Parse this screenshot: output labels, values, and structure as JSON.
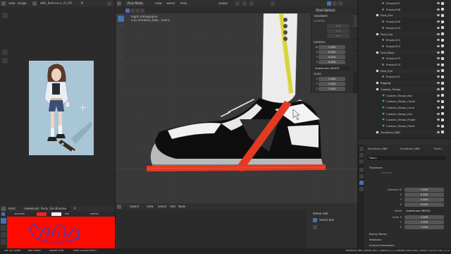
{
  "left_editor": {
    "menu": [
      "View",
      "Image"
    ],
    "image_name": "HBG_Reference_01.JPG"
  },
  "paint_editor": {
    "mode": "Paint",
    "menu": [
      "View",
      "Brush"
    ],
    "brush_name": "Body_SkinShadow",
    "tool_row": {
      "tex_label": "TexDraw",
      "blend": "Mix",
      "radius_label": "Radius"
    }
  },
  "viewport": {
    "mode": "Pose Mode",
    "menu": [
      "View",
      "Select",
      "Pose"
    ],
    "transform_orientation": "Global",
    "view_name": "Right Orthographic",
    "object_info": "(14) Armature_HBG : Foot.L",
    "pose_options": "Pose Options"
  },
  "npanel": {
    "title": "Transform",
    "location_label": "Location",
    "location": [
      "0 m",
      "0 m",
      "0 m"
    ],
    "rotation_label": "Rotation",
    "rotation_axes": [
      "W",
      "X",
      "Y",
      "Z"
    ],
    "rotation": [
      "1.000",
      "0.000",
      "0.000",
      "0.000"
    ],
    "rotation_mode": "Quaternion (WXYZ)",
    "scale_label": "Scale",
    "scale_axes": [
      "X",
      "Y",
      "Z"
    ],
    "scale": [
      "1.000",
      "1.000",
      "1.000"
    ],
    "tabs": [
      "Item",
      "Tool",
      "View",
      "Animation"
    ]
  },
  "node_editor": {
    "header": [
      "Object",
      "View",
      "Select",
      "Add",
      "Node"
    ],
    "active_tool_title": "Active Tool",
    "active_tool_name": "Select Box"
  },
  "outliner": {
    "items": [
      {
        "name": "Empty.007",
        "indent": 1,
        "kind": "empty"
      },
      {
        "name": "Empty.008",
        "indent": 1,
        "kind": "empty"
      },
      {
        "name": "Foot_Arm",
        "indent": 0,
        "kind": "group"
      },
      {
        "name": "Empty.009",
        "indent": 1,
        "kind": "empty"
      },
      {
        "name": "Empty.010",
        "indent": 1,
        "kind": "empty"
      },
      {
        "name": "Foot_Leg",
        "indent": 0,
        "kind": "group"
      },
      {
        "name": "Empty.012",
        "indent": 1,
        "kind": "empty"
      },
      {
        "name": "Empty.013",
        "indent": 1,
        "kind": "empty"
      },
      {
        "name": "Foot_Body",
        "indent": 0,
        "kind": "group"
      },
      {
        "name": "Empty.013",
        "indent": 1,
        "kind": "empty"
      },
      {
        "name": "Empty.014",
        "indent": 1,
        "kind": "empty"
      },
      {
        "name": "Foot_Eye",
        "indent": 0,
        "kind": "group"
      },
      {
        "name": "Empty.021",
        "indent": 1,
        "kind": "empty"
      },
      {
        "name": "Rigging",
        "indent": 0,
        "kind": "group"
      },
      {
        "name": "Custom_Shape",
        "indent": 0,
        "kind": "group"
      },
      {
        "name": "Custom_Shape_Box",
        "indent": 1,
        "kind": "shape"
      },
      {
        "name": "Custom_Shape_Chest",
        "indent": 1,
        "kind": "shape"
      },
      {
        "name": "Custom_Shape_Cone",
        "indent": 1,
        "kind": "shape"
      },
      {
        "name": "Custom_Shape_Eye",
        "indent": 1,
        "kind": "shape"
      },
      {
        "name": "Custom_Shape_Finger",
        "indent": 1,
        "kind": "shape"
      },
      {
        "name": "Custom_Shape_Head",
        "indent": 1,
        "kind": "shape"
      },
      {
        "name": "Armature_HBG",
        "indent": 0,
        "kind": "group"
      }
    ]
  },
  "properties": {
    "breadcrumb": [
      "Armature_HBG",
      "Armature_HBG",
      "Foot.L"
    ],
    "bone_name": "Foot.L",
    "section_transform": "Transform",
    "location_label": "Location",
    "rotation_label": "Rotation W",
    "rotation_axes": [
      "X",
      "Y",
      "Z"
    ],
    "rotation": [
      "1.000",
      "0.000",
      "0.000",
      "0.000"
    ],
    "mode_label": "Mode",
    "mode_value": "Quaternion (WXYZ)",
    "scale_label": "Scale X",
    "scale_axes": [
      "Y",
      "Z"
    ],
    "scale": [
      "1.000",
      "1.000",
      "1.000"
    ],
    "sections": [
      "Bendy Bones",
      "Relations",
      "Inverse Kinematics"
    ]
  },
  "statusbar": {
    "left": [
      "Set 3D Cursor",
      "Box Select",
      "Rotate View",
      "Pose Context Menu"
    ],
    "right": "Armature_HBG | Bones:1/61 | Objects:1/70 | Memory: 898.8 MiB | VRAM: 2.3/24.0 GiB | 3.1.0"
  },
  "colors": {
    "accent_blue": "#4772b3",
    "bone_red": "#e53a22",
    "bone_yellow": "#d4d22a",
    "paint_red": "#ff0a00",
    "ref_bg": "#a9c6d6"
  }
}
